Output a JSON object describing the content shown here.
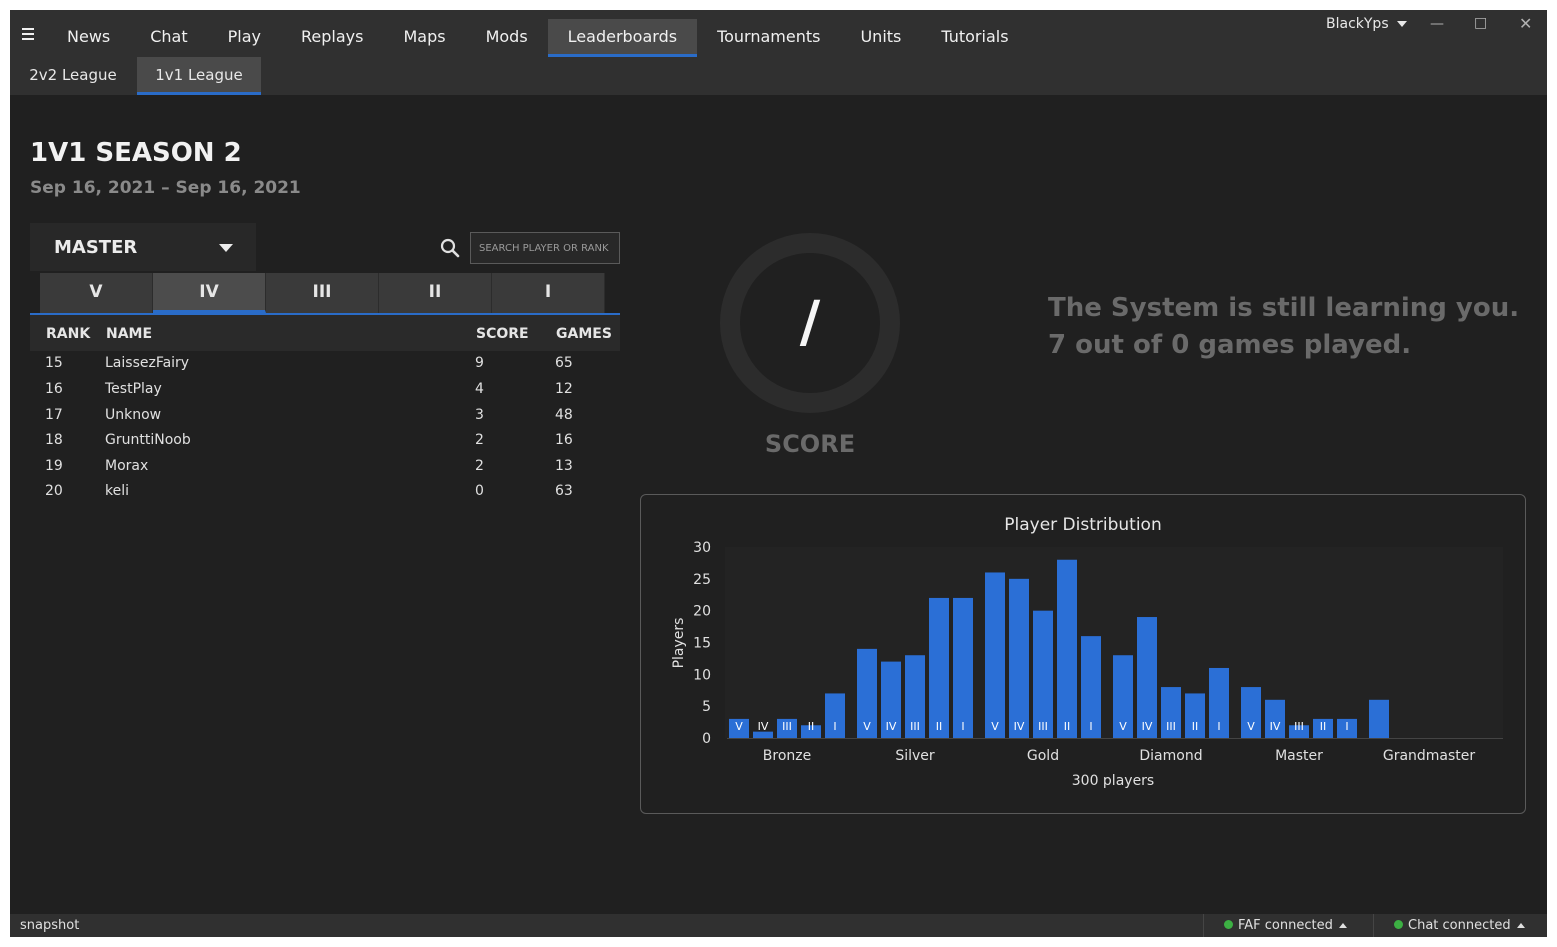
{
  "main_tabs": [
    "News",
    "Chat",
    "Play",
    "Replays",
    "Maps",
    "Mods",
    "Leaderboards",
    "Tournaments",
    "Units",
    "Tutorials"
  ],
  "active_main_tab": "Leaderboards",
  "user": {
    "name": "BlackYps"
  },
  "sub_tabs": [
    "2v2 League",
    "1v1 League"
  ],
  "active_sub_tab": "1v1 League",
  "season": {
    "title": "1V1 SEASON 2",
    "dates": "Sep 16, 2021 – Sep 16, 2021"
  },
  "league_select": {
    "value": "MASTER"
  },
  "search": {
    "placeholder": "SEARCH PLAYER OR RANK"
  },
  "divisions": [
    "V",
    "IV",
    "III",
    "II",
    "I"
  ],
  "active_division": "IV",
  "table": {
    "headers": {
      "rank": "RANK",
      "name": "NAME",
      "score": "SCORE",
      "games": "GAMES"
    },
    "rows": [
      {
        "rank": "15",
        "name": "LaissezFairy",
        "score": "9",
        "games": "65"
      },
      {
        "rank": "16",
        "name": "TestPlay",
        "score": "4",
        "games": "12"
      },
      {
        "rank": "17",
        "name": "Unknow",
        "score": "3",
        "games": "48"
      },
      {
        "rank": "18",
        "name": "GrunttiNoob",
        "score": "2",
        "games": "16"
      },
      {
        "rank": "19",
        "name": "Morax",
        "score": "2",
        "games": "13"
      },
      {
        "rank": "20",
        "name": "keli",
        "score": "0",
        "games": "63"
      }
    ]
  },
  "score_panel": {
    "value": "/",
    "label": "SCORE",
    "message_line1": "The System is still learning you.",
    "message_line2": "7 out of 0 games played."
  },
  "colors": {
    "accent": "#2a6cc8",
    "bar": "#2b6fd6",
    "status_ok": "#3cb043"
  },
  "chart_data": {
    "type": "bar",
    "title": "Player Distribution",
    "ylabel": "Players",
    "xlabel": "300 players",
    "ylim": [
      0,
      30
    ],
    "yticks": [
      0,
      5,
      10,
      15,
      20,
      25,
      30
    ],
    "groups": [
      {
        "name": "Bronze",
        "divisions": [
          "V",
          "IV",
          "III",
          "II",
          "I"
        ],
        "values": [
          3,
          1,
          3,
          2,
          7
        ]
      },
      {
        "name": "Silver",
        "divisions": [
          "V",
          "IV",
          "III",
          "II",
          "I"
        ],
        "values": [
          14,
          12,
          13,
          22,
          22
        ]
      },
      {
        "name": "Gold",
        "divisions": [
          "V",
          "IV",
          "III",
          "II",
          "I"
        ],
        "values": [
          26,
          25,
          20,
          28,
          16
        ]
      },
      {
        "name": "Diamond",
        "divisions": [
          "V",
          "IV",
          "III",
          "II",
          "I"
        ],
        "values": [
          13,
          19,
          8,
          7,
          11
        ]
      },
      {
        "name": "Master",
        "divisions": [
          "V",
          "IV",
          "III",
          "II",
          "I"
        ],
        "values": [
          8,
          6,
          2,
          3,
          3
        ]
      },
      {
        "name": "Grandmaster",
        "divisions": [
          ""
        ],
        "values": [
          6
        ]
      }
    ],
    "grid": false,
    "legend": "none"
  },
  "statusbar": {
    "left": "snapshot",
    "faf": "FAF connected",
    "chat": "Chat connected"
  }
}
